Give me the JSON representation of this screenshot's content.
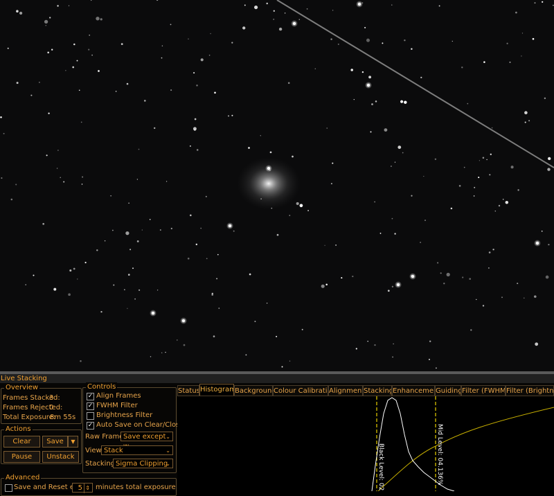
{
  "image_view": {
    "description_icon": "galaxy-star-field"
  },
  "panel": {
    "title": "Live Stacking",
    "overview": {
      "label": "Overview",
      "frames_stacked_label": "Frames Stacked:",
      "frames_stacked_value": "3",
      "frames_rejected_label": "Frames Rejected:",
      "frames_rejected_value": "0",
      "total_exposure_label": "Total Exposure:",
      "total_exposure_value": "8m 55s"
    },
    "actions": {
      "label": "Actions",
      "clear": "Clear",
      "save": "Save",
      "pause": "Pause",
      "unstack": "Unstack"
    },
    "controls": {
      "label": "Controls",
      "align_frames": "Align Frames",
      "align_frames_checked": true,
      "fwhm_filter": "FWHM Filter",
      "fwhm_filter_checked": true,
      "brightness_filter": "Brightness Filter",
      "brightness_filter_checked": false,
      "auto_save": "Auto Save on Clear/Close",
      "auto_save_checked": true,
      "raw_frames_label": "Raw Frames",
      "raw_frames_value": "Save except w",
      "view_label": "View",
      "view_value": "Stack",
      "stacking_label": "Stacking",
      "stacking_value": "Sigma Clipping"
    },
    "advanced": {
      "label": "Advanced",
      "save_reset_label": "Save and Reset every",
      "save_reset_checked": false,
      "minutes_value": "5",
      "minutes_suffix": "minutes total exposure"
    },
    "tabs": [
      "Status",
      "Histogram",
      "Background",
      "Colour Calibration",
      "Alignment",
      "Stacking",
      "Enhancement",
      "Guiding",
      "Filter (FWHM)",
      "Filter (Brightness)"
    ],
    "active_tab": "Histogram",
    "histogram": {
      "black_level_label": "Black Level: 02.11%",
      "mid_level_label": "Mid Level: 04.136%",
      "line_color": "#e8d000",
      "curve_color": "#ffffff"
    }
  }
}
